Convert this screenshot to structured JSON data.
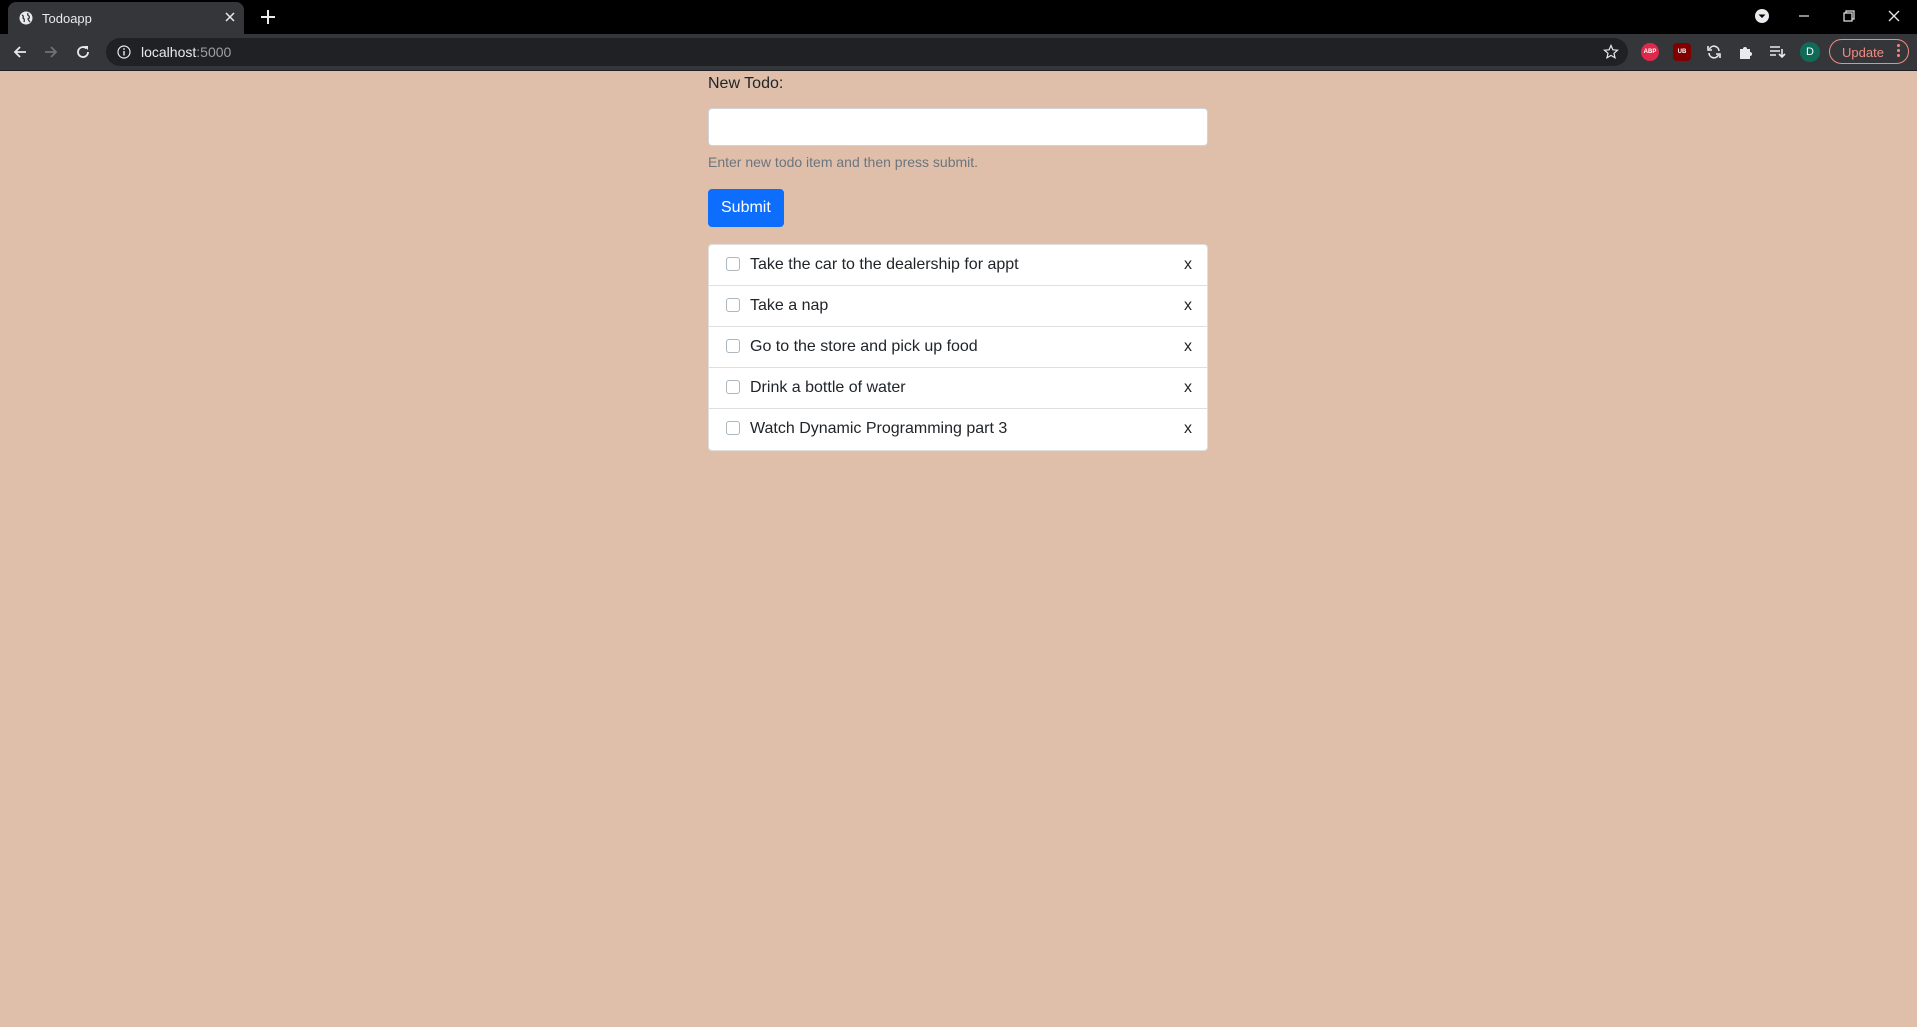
{
  "browser": {
    "tab_title": "Todoapp",
    "url_host": "localhost",
    "url_port": ":5000",
    "profile_initial": "D",
    "update_label": "Update",
    "extensions": [
      "abp-icon",
      "ublock-icon",
      "sync-icon",
      "puzzle-icon",
      "reading-list-icon"
    ],
    "extension_badges": {
      "abp": "ABP",
      "ublock": "UB"
    },
    "accent_color": "#f28b82"
  },
  "form": {
    "label": "New Todo:",
    "input_value": "",
    "help_text": "Enter new todo item and then press submit.",
    "submit_label": "Submit",
    "submit_color": "#0d6efd"
  },
  "todos": {
    "items": [
      {
        "text": "Take the car to the dealership for appt",
        "checked": false,
        "delete_label": "x"
      },
      {
        "text": "Take a nap",
        "checked": false,
        "delete_label": "x"
      },
      {
        "text": "Go to the store and pick up food",
        "checked": false,
        "delete_label": "x"
      },
      {
        "text": "Drink a bottle of water",
        "checked": false,
        "delete_label": "x"
      },
      {
        "text": "Watch Dynamic Programming part 3",
        "checked": false,
        "delete_label": "x"
      }
    ]
  },
  "page": {
    "background_color": "#dfbfaa"
  }
}
